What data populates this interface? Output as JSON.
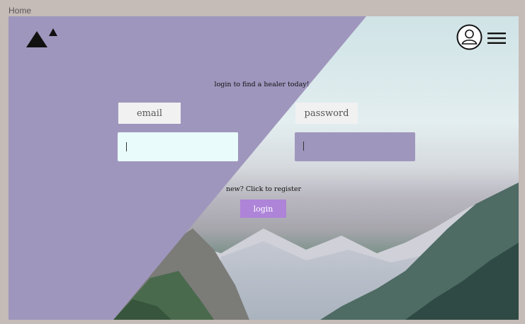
{
  "breadcrumb": {
    "label": "Home"
  },
  "header": {
    "logo_icon": "mountain-logo-icon",
    "account_icon": "user-circle-icon",
    "menu_icon": "hamburger-menu-icon"
  },
  "login": {
    "tagline": "login to find a healer today!",
    "email_label": "email",
    "password_label": "password",
    "email_value": "",
    "password_value": "",
    "register_link": "new? Click to register",
    "submit_label": "login"
  },
  "colors": {
    "overlay": "#9f96bd",
    "email_field": "#e9fbfa",
    "password_field": "#9f96bd",
    "button": "#ae84d8",
    "page_bg": "#c5bbb7"
  }
}
